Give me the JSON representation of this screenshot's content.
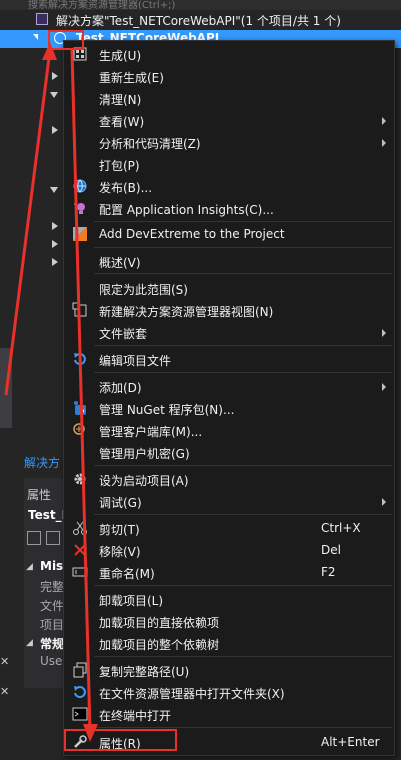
{
  "explorer": {
    "search_hint": "搜索解决方案资源管理器(Ctrl+;)",
    "solution_label": "解决方案\"Test_NETCoreWebAPI\"(1 个项目/共 1 个)",
    "project_label": "Test_NETCoreWebAPI",
    "tab_label": "解决方",
    "props_title": "属性",
    "props_object": "Test_N",
    "group_misc": "Mis",
    "misc_items": [
      "完整",
      "文件",
      "项目"
    ],
    "group_common": "常规",
    "common_item": "Use"
  },
  "menu": {
    "items": [
      {
        "label": "生成(U)",
        "icon": "build-icon",
        "submenu": false
      },
      {
        "label": "重新生成(E)",
        "submenu": false
      },
      {
        "label": "清理(N)",
        "submenu": false
      },
      {
        "label": "查看(W)",
        "submenu": true
      },
      {
        "label": "分析和代码清理(Z)",
        "submenu": true
      },
      {
        "label": "打包(P)",
        "submenu": false
      },
      {
        "label": "发布(B)...",
        "icon": "globe-icon",
        "submenu": false
      },
      {
        "label": "配置 Application Insights(C)...",
        "icon": "bulb-icon",
        "submenu": false
      },
      {
        "label": "Add DevExtreme to the Project",
        "icon": "devextreme-icon",
        "submenu": false
      },
      {
        "label": "概述(V)",
        "submenu": false
      },
      {
        "label": "限定为此范围(S)",
        "submenu": false
      },
      {
        "label": "新建解决方案资源管理器视图(N)",
        "icon": "new-view-icon",
        "submenu": false
      },
      {
        "label": "文件嵌套",
        "submenu": true
      },
      {
        "label": "编辑项目文件",
        "icon": "refresh-icon",
        "submenu": false
      },
      {
        "label": "添加(D)",
        "submenu": true
      },
      {
        "label": "管理 NuGet 程序包(N)...",
        "icon": "nuget-icon",
        "submenu": false
      },
      {
        "label": "管理客户端库(M)...",
        "icon": "library-icon",
        "submenu": false
      },
      {
        "label": "管理用户机密(G)",
        "submenu": false
      },
      {
        "label": "设为启动项目(A)",
        "icon": "gear-icon",
        "submenu": false
      },
      {
        "label": "调试(G)",
        "submenu": true
      },
      {
        "label": "剪切(T)",
        "shortcut": "Ctrl+X",
        "icon": "scissors-icon",
        "submenu": false
      },
      {
        "label": "移除(V)",
        "shortcut": "Del",
        "icon": "remove-icon",
        "submenu": false
      },
      {
        "label": "重命名(M)",
        "shortcut": "F2",
        "icon": "rename-icon",
        "submenu": false
      },
      {
        "label": "卸载项目(L)",
        "submenu": false
      },
      {
        "label": "加载项目的直接依赖项",
        "submenu": false
      },
      {
        "label": "加载项目的整个依赖树",
        "submenu": false
      },
      {
        "label": "复制完整路径(U)",
        "icon": "copy-icon",
        "submenu": false
      },
      {
        "label": "在文件资源管理器中打开文件夹(X)",
        "icon": "open-folder-icon",
        "submenu": false
      },
      {
        "label": "在终端中打开",
        "icon": "terminal-icon",
        "submenu": false
      },
      {
        "label": "属性(R)",
        "shortcut": "Alt+Enter",
        "icon": "wrench-icon",
        "submenu": false
      }
    ]
  },
  "colors": {
    "menu_bg": "#1b1b1c",
    "selection": "#3399ff",
    "annotation": "#e8312a"
  }
}
